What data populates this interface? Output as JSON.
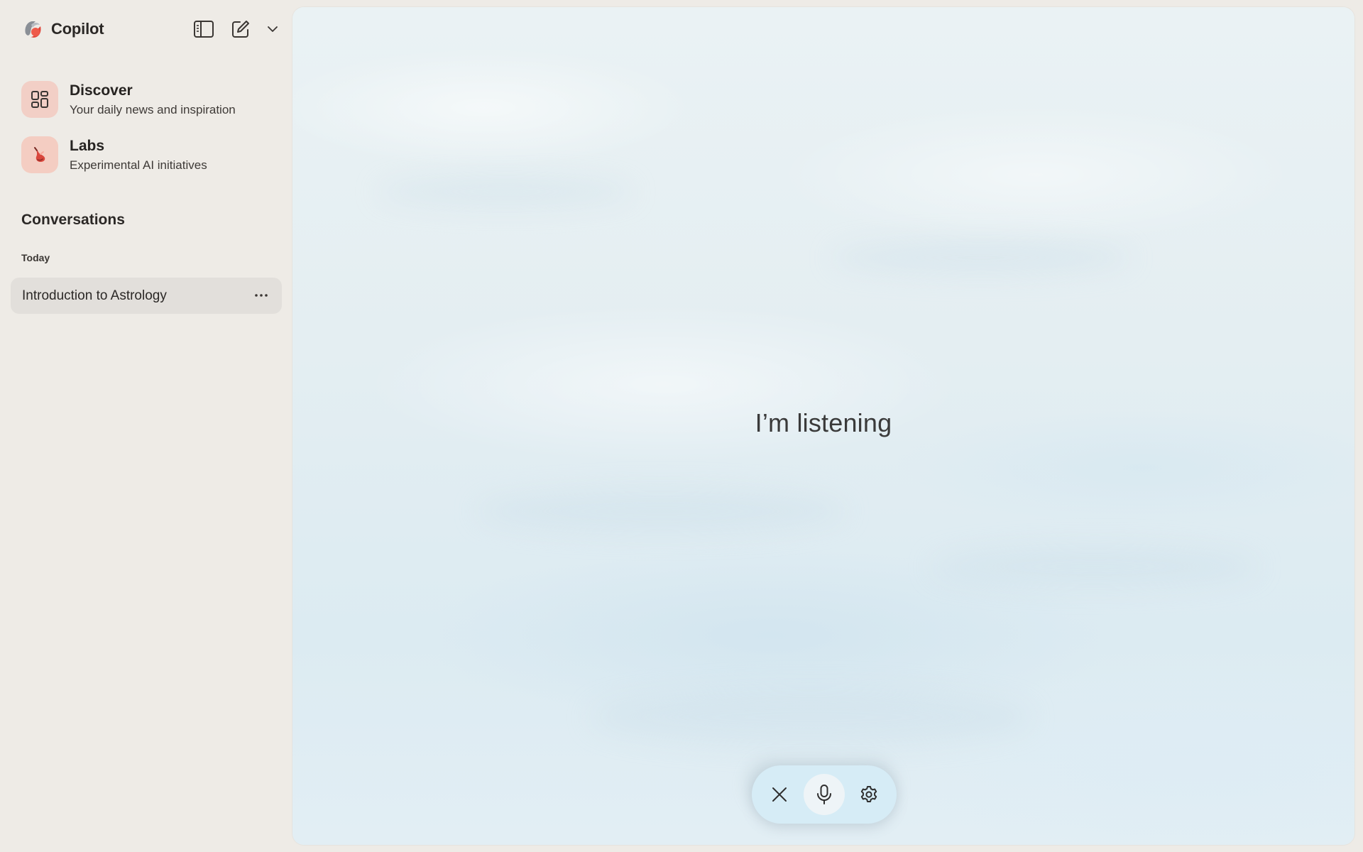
{
  "app": {
    "name": "Copilot"
  },
  "sidebar": {
    "nav": [
      {
        "title": "Discover",
        "subtitle": "Your daily news and inspiration",
        "icon": "grid-icon"
      },
      {
        "title": "Labs",
        "subtitle": "Experimental AI initiatives",
        "icon": "labs-icon"
      }
    ],
    "section_title": "Conversations",
    "groups": [
      {
        "label": "Today",
        "items": [
          {
            "title": "Introduction to Astrology"
          }
        ]
      }
    ]
  },
  "main": {
    "status_text": "I’m listening",
    "controls": {
      "close_icon": "close-icon",
      "mic_icon": "microphone-icon",
      "settings_icon": "gear-icon"
    }
  },
  "colors": {
    "sidebar_bg": "#eeebe6",
    "selected_item_bg": "#e2dfdb",
    "nav_icon_bg": "#f2cfc6",
    "control_bar_bg": "#d6ecf6"
  }
}
